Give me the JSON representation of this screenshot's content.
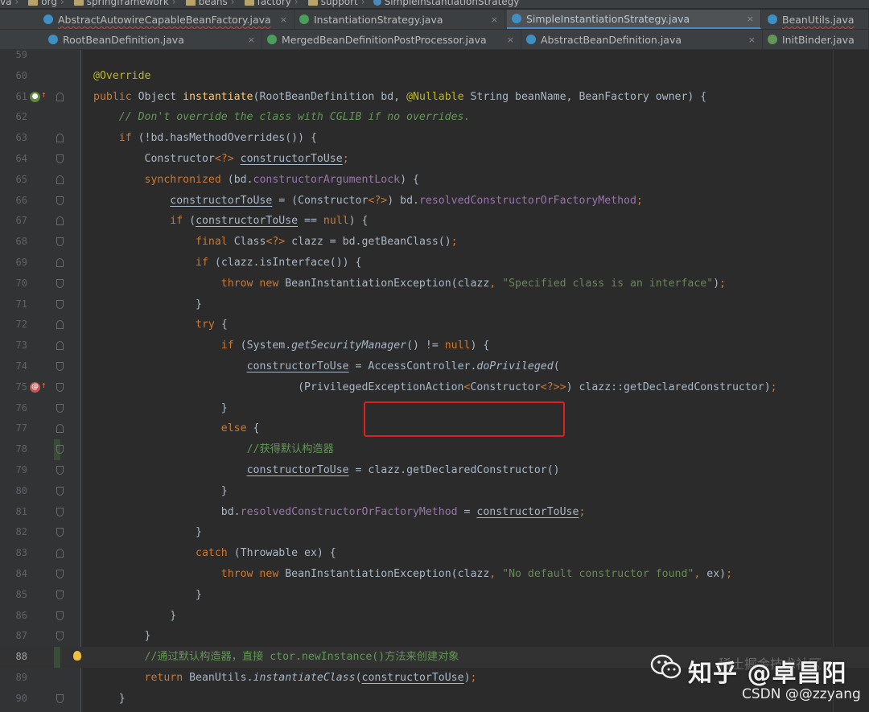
{
  "breadcrumbs": [
    "va",
    "org",
    "springframework",
    "beans",
    "factory",
    "support",
    "SimpleInstantiationStrategy"
  ],
  "tabs_row1": [
    {
      "label": "AbstractAutowireCapableBeanFactory.java",
      "icon": "class-icon"
    },
    {
      "label": "InstantiationStrategy.java",
      "icon": "interface-icon"
    },
    {
      "label": "SimpleInstantiationStrategy.java",
      "icon": "class-icon",
      "active": true
    },
    {
      "label": "BeanUtils.java",
      "icon": "class-icon"
    }
  ],
  "tabs_row2": [
    {
      "label": "RootBeanDefinition.java",
      "icon": "class-icon"
    },
    {
      "label": "MergedBeanDefinitionPostProcessor.java",
      "icon": "interface-icon"
    },
    {
      "label": "AbstractBeanDefinition.java",
      "icon": "class-icon"
    },
    {
      "label": "InitBinder.java",
      "icon": "annotation-icon"
    }
  ],
  "close_glyph": "×",
  "line_numbers": [
    "59",
    "60",
    "61",
    "62",
    "63",
    "64",
    "65",
    "66",
    "67",
    "68",
    "69",
    "70",
    "71",
    "72",
    "73",
    "74",
    "75",
    "76",
    "77",
    "78",
    "79",
    "80",
    "81",
    "82",
    "83",
    "84",
    "85",
    "86",
    "87",
    "88",
    "89",
    "90"
  ],
  "code_lines": [
    [],
    [
      {
        "t": "@Override",
        "c": "an"
      }
    ],
    [
      {
        "t": "public ",
        "c": "kw"
      },
      {
        "t": "Object "
      },
      {
        "t": "instantiate",
        "c": "fn"
      },
      {
        "t": "(RootBeanDefinition bd, "
      },
      {
        "t": "@Nullable ",
        "c": "an"
      },
      {
        "t": "String beanName, BeanFactory owner) {"
      }
    ],
    [
      {
        "t": "    "
      },
      {
        "t": "// Don't override the class with CGLIB if no overrides.",
        "c": "cm"
      }
    ],
    [
      {
        "t": "    "
      },
      {
        "t": "if ",
        "c": "kw"
      },
      {
        "t": "(!bd.hasMethodOverrides()) {"
      }
    ],
    [
      {
        "t": "        Constructor"
      },
      {
        "t": "<?>",
        "c": "kw"
      },
      {
        "t": " "
      },
      {
        "t": "constructorToUse",
        "c": "ul"
      },
      {
        "t": ";",
        "c": "kw"
      }
    ],
    [
      {
        "t": "        "
      },
      {
        "t": "synchronized ",
        "c": "kw"
      },
      {
        "t": "(bd."
      },
      {
        "t": "constructorArgumentLock",
        "c": "fld"
      },
      {
        "t": ") {"
      }
    ],
    [
      {
        "t": "            "
      },
      {
        "t": "constructorToUse",
        "c": "ul"
      },
      {
        "t": " = (Constructor"
      },
      {
        "t": "<?>",
        "c": "kw"
      },
      {
        "t": ") bd."
      },
      {
        "t": "resolvedConstructorOrFactoryMethod",
        "c": "fld"
      },
      {
        "t": ";",
        "c": "kw"
      }
    ],
    [
      {
        "t": "            "
      },
      {
        "t": "if ",
        "c": "kw"
      },
      {
        "t": "("
      },
      {
        "t": "constructorToUse",
        "c": "ul"
      },
      {
        "t": " == "
      },
      {
        "t": "null",
        "c": "kw"
      },
      {
        "t": ") {"
      }
    ],
    [
      {
        "t": "                "
      },
      {
        "t": "final ",
        "c": "kw"
      },
      {
        "t": "Class"
      },
      {
        "t": "<?>",
        "c": "kw"
      },
      {
        "t": " clazz = bd.getBeanClass()"
      },
      {
        "t": ";",
        "c": "kw"
      }
    ],
    [
      {
        "t": "                "
      },
      {
        "t": "if ",
        "c": "kw"
      },
      {
        "t": "(clazz.isInterface()) {"
      }
    ],
    [
      {
        "t": "                    "
      },
      {
        "t": "throw new ",
        "c": "kw"
      },
      {
        "t": "BeanInstantiationException(clazz"
      },
      {
        "t": ", ",
        "c": "kw"
      },
      {
        "t": "\"Specified class is an interface\"",
        "c": "str"
      },
      {
        "t": ")"
      },
      {
        "t": ";",
        "c": "kw"
      }
    ],
    [
      {
        "t": "                }"
      }
    ],
    [
      {
        "t": "                "
      },
      {
        "t": "try ",
        "c": "kw"
      },
      {
        "t": "{"
      }
    ],
    [
      {
        "t": "                    "
      },
      {
        "t": "if ",
        "c": "kw"
      },
      {
        "t": "(System."
      },
      {
        "t": "getSecurityManager",
        "c": "it"
      },
      {
        "t": "() != "
      },
      {
        "t": "null",
        "c": "kw"
      },
      {
        "t": ") {"
      }
    ],
    [
      {
        "t": "                        "
      },
      {
        "t": "constructorToUse",
        "c": "ul"
      },
      {
        "t": " = AccessController."
      },
      {
        "t": "doPrivileged",
        "c": "it"
      },
      {
        "t": "("
      }
    ],
    [
      {
        "t": "                                (PrivilegedExceptionAction"
      },
      {
        "t": "<",
        "c": "kw"
      },
      {
        "t": "Constructor"
      },
      {
        "t": "<?>>",
        "c": "kw"
      },
      {
        "t": ") clazz::getDeclaredConstructor)"
      },
      {
        "t": ";",
        "c": "kw"
      }
    ],
    [
      {
        "t": "                    }"
      }
    ],
    [
      {
        "t": "                    "
      },
      {
        "t": "else ",
        "c": "kw"
      },
      {
        "t": "{"
      }
    ],
    [
      {
        "t": "                        "
      },
      {
        "t": "//获得默认构造器",
        "c": "cmz"
      }
    ],
    [
      {
        "t": "                        "
      },
      {
        "t": "constructorToUse",
        "c": "ul"
      },
      {
        "t": " = clazz.getDeclaredConstructor()"
      }
    ],
    [
      {
        "t": "                    }"
      }
    ],
    [
      {
        "t": "                    bd."
      },
      {
        "t": "resolvedConstructorOrFactoryMethod",
        "c": "fld"
      },
      {
        "t": " = "
      },
      {
        "t": "constructorToUse",
        "c": "ul"
      },
      {
        "t": ";",
        "c": "kw"
      }
    ],
    [
      {
        "t": "                }"
      }
    ],
    [
      {
        "t": "                "
      },
      {
        "t": "catch ",
        "c": "kw"
      },
      {
        "t": "(Throwable ex) {"
      }
    ],
    [
      {
        "t": "                    "
      },
      {
        "t": "throw new ",
        "c": "kw"
      },
      {
        "t": "BeanInstantiationException(clazz"
      },
      {
        "t": ", ",
        "c": "kw"
      },
      {
        "t": "\"No default constructor found\"",
        "c": "str"
      },
      {
        "t": ", ",
        "c": "kw"
      },
      {
        "t": "ex)"
      },
      {
        "t": ";",
        "c": "kw"
      }
    ],
    [
      {
        "t": "                }"
      }
    ],
    [
      {
        "t": "            }"
      }
    ],
    [
      {
        "t": "        }"
      }
    ],
    [
      {
        "t": "        "
      },
      {
        "t": "//通过默认构造器，直接 ctor.newInstance()方法来创建对象",
        "c": "cmz"
      }
    ],
    [
      {
        "t": "        "
      },
      {
        "t": "return ",
        "c": "kw"
      },
      {
        "t": "BeanUtils."
      },
      {
        "t": "instantiateClass",
        "c": "it"
      },
      {
        "t": "("
      },
      {
        "t": "constructorToUse",
        "c": "ul"
      },
      {
        "t": ")"
      },
      {
        "t": ";",
        "c": "kw"
      }
    ],
    [
      {
        "t": "    }"
      }
    ]
  ],
  "watermark": {
    "zhihu": "知乎 @卓昌阳",
    "csdn": "CSDN @@zzyang",
    "wechat_text": "稀土掘金技术社区"
  },
  "colors": {
    "keyword": "#cc7832",
    "annotation": "#bbb529",
    "method": "#ffc66d",
    "string": "#6a8759",
    "comment": "#629755",
    "field": "#9876aa",
    "highlight": "#e02020"
  }
}
